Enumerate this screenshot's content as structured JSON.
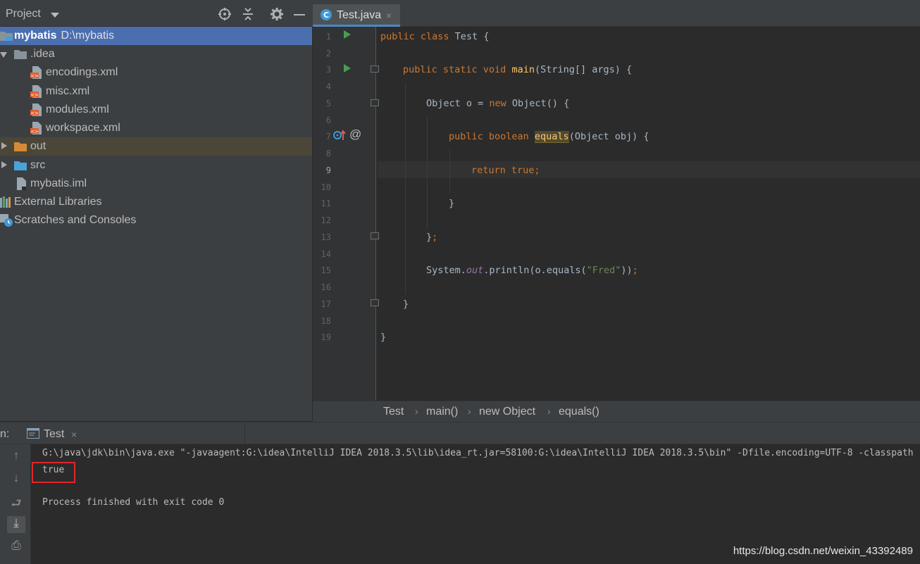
{
  "project_panel": {
    "title": "Project",
    "tree": [
      {
        "name": "mybatis",
        "path": "D:\\mybatis"
      },
      {
        "name": ".idea"
      },
      {
        "name": "encodings.xml"
      },
      {
        "name": "misc.xml"
      },
      {
        "name": "modules.xml"
      },
      {
        "name": "workspace.xml"
      },
      {
        "name": "out"
      },
      {
        "name": "src"
      },
      {
        "name": "mybatis.iml"
      },
      {
        "name": "External Libraries"
      },
      {
        "name": "Scratches and Consoles"
      }
    ],
    "header_icons": [
      "locate-icon",
      "collapse-icon",
      "gear-icon",
      "minimize-icon"
    ]
  },
  "editor": {
    "tab_label": "Test.java",
    "tab_close": "×",
    "line_numbers": [
      "1",
      "2",
      "3",
      "4",
      "5",
      "6",
      "7",
      "8",
      "9",
      "10",
      "11",
      "12",
      "13",
      "14",
      "15",
      "16",
      "17",
      "18",
      "19"
    ],
    "active_line": "9",
    "gutter_marker": "@",
    "code": {
      "l1_kw": "public class ",
      "l1_rest": "Test {",
      "l3_kw": "public static void ",
      "l3_fn": "main",
      "l3_rest": "(String[] args) {",
      "l5_pre": "Object o = ",
      "l5_kw": "new ",
      "l5_rest": "Object() {",
      "l7_kw": "public boolean ",
      "l7_fn": "equals",
      "l7_rest": "(Object obj) {",
      "l9_kw": "return true",
      "l9_rest": ";",
      "l11": "}",
      "l13_pre": "}",
      "l13_kw": ";",
      "l15_pre": "System.",
      "l15_field": "out",
      "l15_mid": ".println(o.equals(",
      "l15_str": "\"Fred\"",
      "l15_end": "))",
      "l15_semi": ";",
      "l17": "}",
      "l19": "}"
    }
  },
  "breadcrumb": {
    "items": [
      "Test",
      "main()",
      "new Object",
      "equals()"
    ],
    "separator": "›"
  },
  "run_panel": {
    "prefix": "n:",
    "tab_label": "Test",
    "tab_close": "×",
    "console": {
      "command": "G:\\java\\jdk\\bin\\java.exe \"-javaagent:G:\\idea\\IntelliJ IDEA 2018.3.5\\lib\\idea_rt.jar=58100:G:\\idea\\IntelliJ IDEA 2018.3.5\\bin\" -Dfile.encoding=UTF-8 -classpath",
      "output": "true",
      "exit": "Process finished with exit code 0"
    },
    "toolbar_icons": [
      "up-arrow-icon",
      "down-arrow-icon",
      "soft-wrap-icon",
      "scroll-to-end-icon",
      "print-icon"
    ],
    "toolbar_glyphs": [
      "↑",
      "↓",
      "⮐",
      "⤓",
      "⎙"
    ]
  },
  "watermark": "https://blog.csdn.net/weixin_43392489",
  "colors": {
    "accent_selection": "#4b6eaf",
    "keyword": "#cc7832",
    "function": "#ffc66d",
    "string": "#6a8759",
    "highlight_box": "#e0262a"
  }
}
